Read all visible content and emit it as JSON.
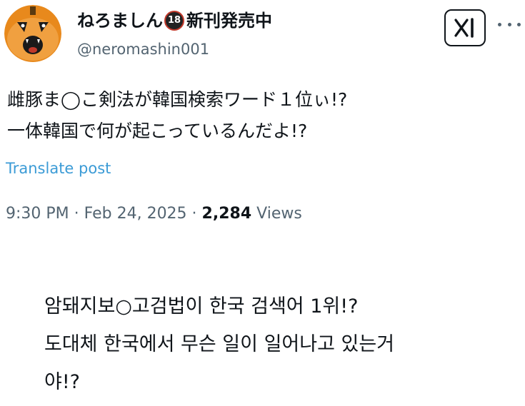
{
  "tweet": {
    "author": {
      "display_name": "ねろましん",
      "badge": "18",
      "name_suffix": "新刊発売中",
      "handle": "@neromashin001",
      "avatar_icon": "pumpkin-face-avatar"
    },
    "header_actions": {
      "grok_icon": "x-grok-logo-icon",
      "more_icon": "more-dots-icon"
    },
    "body_lines": [
      "雌豚ま◯こ剣法が韓国検索ワード１位ぃ!?",
      "一体韓国で何が起こっているんだよ!?"
    ],
    "translate_label": "Translate post",
    "meta": {
      "time": "9:30 PM",
      "separator": " · ",
      "date": "Feb 24, 2025",
      "views_count": "2,284",
      "views_label": "Views"
    },
    "colors": {
      "translate_link": "#3b9bd6",
      "secondary_text": "#536471",
      "primary_text": "#0f1419",
      "avatar_orange": "#e8891c"
    }
  },
  "translation_caption": {
    "lines": [
      "암돼지보○고검법이 한국 검색어 1위!?",
      "도대체 한국에서 무슨 일이 일어나고 있는거",
      "야!?"
    ]
  }
}
